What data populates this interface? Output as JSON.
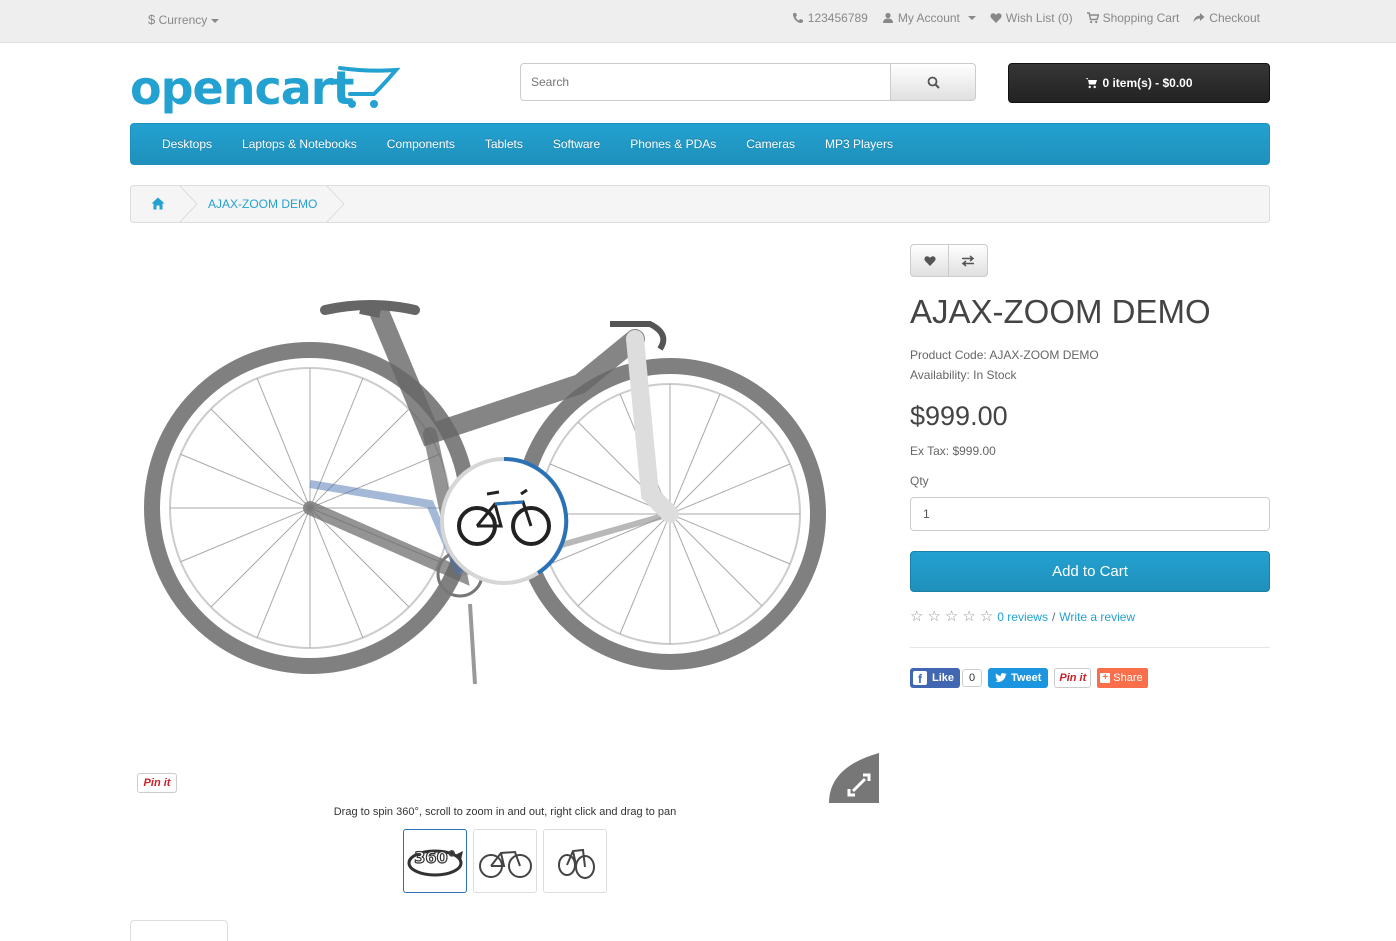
{
  "topbar": {
    "currency_symbol": "$",
    "currency_label": "Currency",
    "phone": "123456789",
    "my_account": "My Account",
    "wish_list": "Wish List (0)",
    "shopping_cart": "Shopping Cart",
    "checkout": "Checkout"
  },
  "header": {
    "logo_text": "opencart",
    "search_placeholder": "Search",
    "cart_label": "0 item(s) - $0.00"
  },
  "nav": {
    "items": [
      "Desktops",
      "Laptops & Notebooks",
      "Components",
      "Tablets",
      "Software",
      "Phones & PDAs",
      "Cameras",
      "MP3 Players"
    ]
  },
  "breadcrumb": {
    "current": "AJAX-ZOOM DEMO"
  },
  "gallery": {
    "pinit_label": "Pin it",
    "hint": "Drag to spin 360°, scroll to zoom in and out, right click and drag to pan",
    "thumb_360_label": "360°"
  },
  "product": {
    "title": "AJAX-ZOOM DEMO",
    "code_label": "Product Code: AJAX-ZOOM DEMO",
    "availability_label": "Availability: In Stock",
    "price": "$999.00",
    "ex_tax": "Ex Tax: $999.00",
    "qty_label": "Qty",
    "qty_value": "1",
    "add_to_cart": "Add to Cart",
    "rating_stars": 0,
    "reviews_link": "0 reviews",
    "review_separator": "/",
    "write_review_link": "Write a review"
  },
  "social": {
    "fb_like": "Like",
    "fb_count": "0",
    "tweet": "Tweet",
    "pinit": "Pin it",
    "share": "Share"
  },
  "colors": {
    "brand_blue": "#23a1d1",
    "cart_dark": "#222222",
    "facebook": "#4267b2",
    "twitter": "#1b95e0",
    "pinterest": "#cb2027",
    "share": "#f96e4b"
  }
}
